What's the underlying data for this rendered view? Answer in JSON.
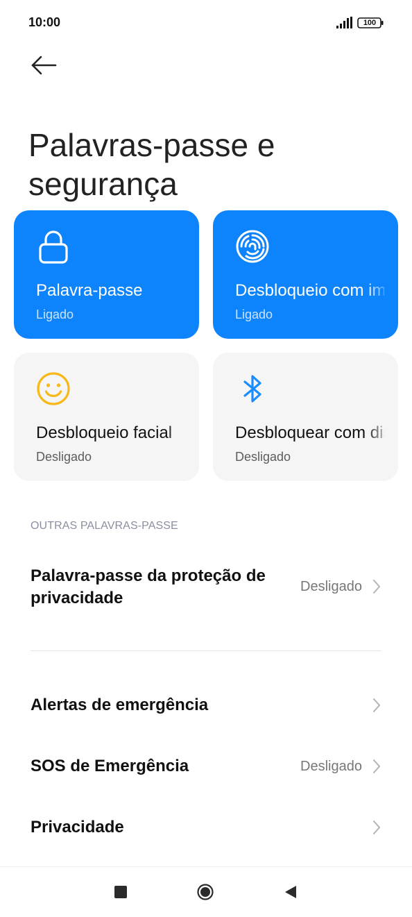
{
  "status_bar": {
    "time": "10:00",
    "battery": "100"
  },
  "page_title": "Palavras-passe e segurança",
  "tiles": [
    {
      "title": "Palavra-passe",
      "subtitle": "Ligado",
      "icon": "lock-icon",
      "active": true
    },
    {
      "title": "Desbloqueio com impressão digital",
      "subtitle": "Ligado",
      "icon": "fingerprint-icon",
      "active": true
    },
    {
      "title": "Desbloqueio facial",
      "subtitle": "Desligado",
      "icon": "smiley-face-icon",
      "active": false
    },
    {
      "title": "Desbloquear com dispositivo Bluetooth",
      "subtitle": "Desligado",
      "icon": "bluetooth-icon",
      "active": false
    }
  ],
  "section": {
    "header": "OUTRAS PALAVRAS-PASSE"
  },
  "list": [
    {
      "title": "Palavra-passe da proteção de privacidade",
      "value": "Desligado"
    },
    {
      "title": "Alertas de emergência",
      "value": ""
    },
    {
      "title": "SOS de Emergência",
      "value": "Desligado"
    },
    {
      "title": "Privacidade",
      "value": ""
    }
  ],
  "colors": {
    "accent": "#0e84fc",
    "tile_inactive": "#f5f5f5",
    "face_icon": "#f7b81a",
    "bluetooth_icon": "#1a8cff"
  }
}
